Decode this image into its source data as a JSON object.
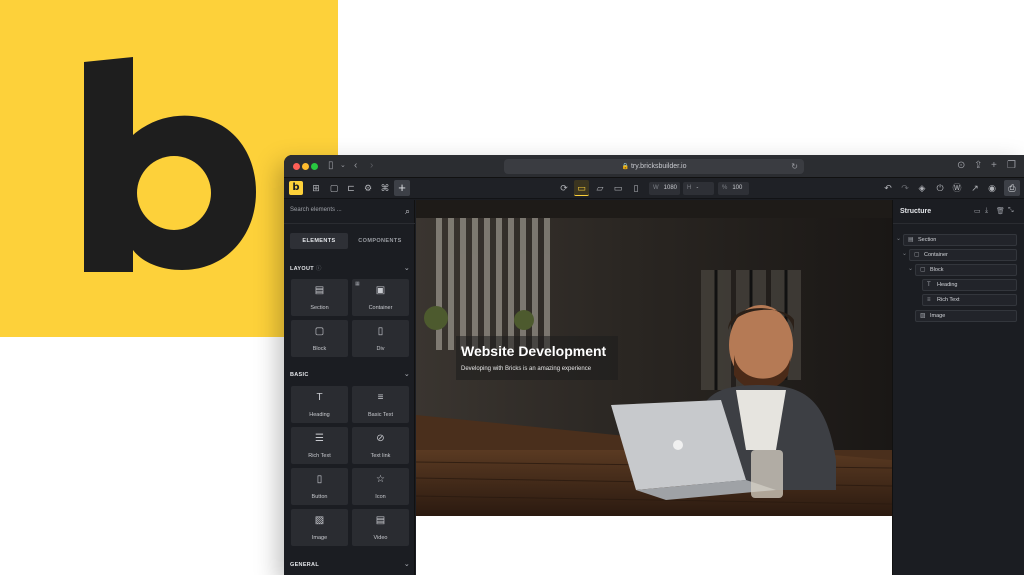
{
  "browser": {
    "url": "try.bricksbuilder.io"
  },
  "toolbar": {
    "dims": [
      {
        "label": "W",
        "value": "1080"
      },
      {
        "label": "H",
        "value": "-"
      },
      {
        "label": "%",
        "value": "100"
      }
    ]
  },
  "left_panel": {
    "search_placeholder": "Search elements ...",
    "tabs": [
      "ELEMENTS",
      "COMPONENTS"
    ],
    "categories": [
      {
        "name": "LAYOUT",
        "items": [
          "Section",
          "Container",
          "Block",
          "Div"
        ]
      },
      {
        "name": "BASIC",
        "items": [
          "Heading",
          "Basic Text",
          "Rich Text",
          "Text link",
          "Button",
          "Icon",
          "Image",
          "Video"
        ]
      },
      {
        "name": "GENERAL",
        "items": []
      }
    ]
  },
  "canvas": {
    "hero_title": "Website Development",
    "hero_subtitle": "Developing with Bricks is an amazing experience"
  },
  "structure": {
    "title": "Structure",
    "nodes": [
      "Section",
      "Container",
      "Block",
      "Heading",
      "Rich Text",
      "Image"
    ]
  },
  "colors": {
    "brand_yellow": "#fdd13a",
    "panel_bg": "#1b1d22"
  }
}
